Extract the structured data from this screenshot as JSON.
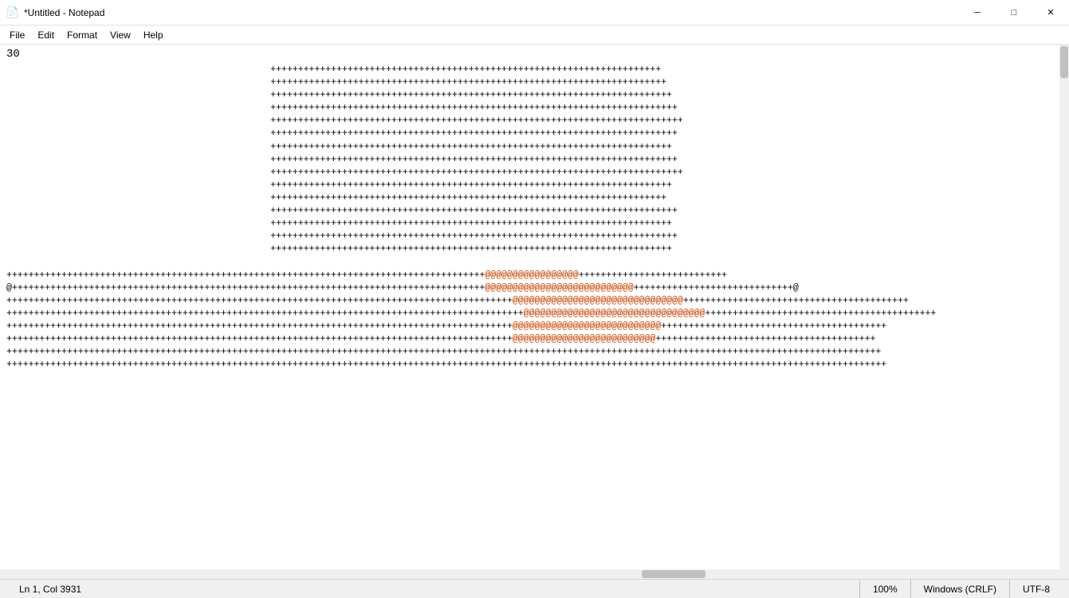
{
  "titlebar": {
    "title": "*Untitled - Notepad",
    "icon": "📄",
    "minimize_label": "─",
    "maximize_label": "□",
    "close_label": "✕"
  },
  "menubar": {
    "items": [
      "File",
      "Edit",
      "Format",
      "View",
      "Help"
    ]
  },
  "editor": {
    "first_line": "30",
    "plus_lines": [
      "+++++++++++++++++++++++++++++++++++++++++++++++++++++++++++++++++++++++",
      "++++++++++++++++++++++++++++++++++++++++++++++++++++++++++++++++++++++++",
      "+++++++++++++++++++++++++++++++++++++++++++++++++++++++++++++++++++++++++",
      "++++++++++++++++++++++++++++++++++++++++++++++++++++++++++++++++++++++++++",
      "+++++++++++++++++++++++++++++++++++++++++++++++++++++++++++++++++++++++++++",
      "++++++++++++++++++++++++++++++++++++++++++++++++++++++++++++++++++++++++++",
      "+++++++++++++++++++++++++++++++++++++++++++++++++++++++++++++++++++++++++",
      "++++++++++++++++++++++++++++++++++++++++++++++++++++++++++++++++++++++++++",
      "+++++++++++++++++++++++++++++++++++++++++++++++++++++++++++++++++++++++++++",
      "+++++++++++++++++++++++++++++++++++++++++++++++++++++++++++++++++++++++++",
      "++++++++++++++++++++++++++++++++++++++++++++++++++++++++++++++++++++++++",
      "++++++++++++++++++++++++++++++++++++++++++++++++++++++++++++++++++++++++++",
      "+++++++++++++++++++++++++++++++++++++++++++++++++++++++++++++++++++++++++",
      "++++++++++++++++++++++++++++++++++++++++++++++++++++++++++++++++++++++++++",
      "+++++++++++++++++++++++++++++++++++++++++++++++++++++++++++++++++++++++++"
    ],
    "mixed_lines": [
      {
        "before": "+++++++++++++++++++++++++++++++++++++++++++++++++++++++++++++++++++++++++++++++++++++++",
        "at": "@@@@@@@@@@@@@@@@@",
        "after": "+++++++++++++++++++++++++++"
      },
      {
        "before": "@++++++++++++++++++++++++++++++++++++++++++++++++++++++++++++++++++++++++++++++++++++++",
        "at": "@@@@@@@@@@@@@@@@@@@@@@@@@@@",
        "after": "+++++++++++++++++++++++++++++@"
      },
      {
        "before": "++++++++++++++++++++++++++++++++++++++++++++++++++++++++++++++++++++++++++++++++++++++++++++",
        "at": "@@@@@@@@@@@@@@@@@@@@@@@@@@@@@@@",
        "after": "+++++++++++++++++++++++++++++++++++++++++"
      },
      {
        "before": "++++++++++++++++++++++++++++++++++++++++++++++++++++++++++++++++++++++++++++++++++++++++++++++",
        "at": "@@@@@@@@@@@@@@@@@@@@@@@@@@@@@@@@@",
        "after": "++++++++++++++++++++++++++++++++++++++++++"
      },
      {
        "before": "++++++++++++++++++++++++++++++++++++++++++++++++++++++++++++++++++++++++++++++++++++++++++++",
        "at": "@@@@@@@@@@@@@@@@@@@@@@@@@@@",
        "after": "+++++++++++++++++++++++++++++++++++++++++"
      },
      {
        "before": "++++++++++++++++++++++++++++++++++++++++++++++++++++++++++++++++++++++++++++++++++++++++++++",
        "at": "@@@@@@@@@@@@@@@@@@@@@@@@@@",
        "after": "++++++++++++++++++++++++++++++++++++++++"
      },
      {
        "before": "++++++++++++++++++++++++++++++++++++++++++++++++++++++++++++++++++++++++++++++++++++++++++++++++++++++",
        "at": "",
        "after": "+++++++++++++++++++++++++++++++++++++++++++++++++++++++++"
      },
      {
        "before": "++++++++++++++++++++++++++++++++++++++++++++++++++++++++++++++++++++++++++++++++++++++++++++++++++++++++",
        "at": "",
        "after": "++++++++++++++++++++++++++++++++++++++++++++++++++++++++"
      }
    ]
  },
  "statusbar": {
    "position": "Ln 1, Col 3931",
    "zoom": "100%",
    "line_ending": "Windows (CRLF)",
    "encoding": "UTF-8"
  }
}
